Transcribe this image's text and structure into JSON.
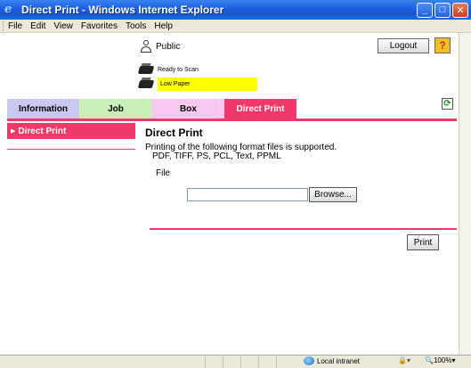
{
  "window": {
    "title": "Direct Print - Windows Internet Explorer",
    "minimize": "_",
    "maximize": "□",
    "close": "✕"
  },
  "menu": {
    "items": [
      "File",
      "Edit",
      "View",
      "Favorites",
      "Tools",
      "Help"
    ]
  },
  "header": {
    "user": "Public",
    "logout_label": "Logout",
    "help_label": "?",
    "refresh_label": "⟳",
    "status_scan": "Ready to Scan",
    "status_paper": "Low Paper"
  },
  "tabs": [
    {
      "label": "Information"
    },
    {
      "label": "Job"
    },
    {
      "label": "Box"
    },
    {
      "label": "Direct Print",
      "active": true
    }
  ],
  "sidebar": {
    "items": [
      {
        "label": "Direct Print",
        "active": true
      }
    ]
  },
  "main": {
    "title": "Direct Print",
    "desc_line1": "Printing of the following format files is supported.",
    "desc_line2": "PDF, TIFF, PS, PCL, Text, PPML",
    "file_label": "File",
    "file_value": "",
    "browse_label": "Browse...",
    "print_label": "Print"
  },
  "statusbar": {
    "zone": "Local intranet",
    "zoom": "100%"
  },
  "colors": {
    "accent": "#f0386a",
    "tab_information": "#c8c8f0",
    "tab_job": "#c8f0b8",
    "tab_box": "#f8c8f0",
    "paper_warning": "#ffff00"
  }
}
